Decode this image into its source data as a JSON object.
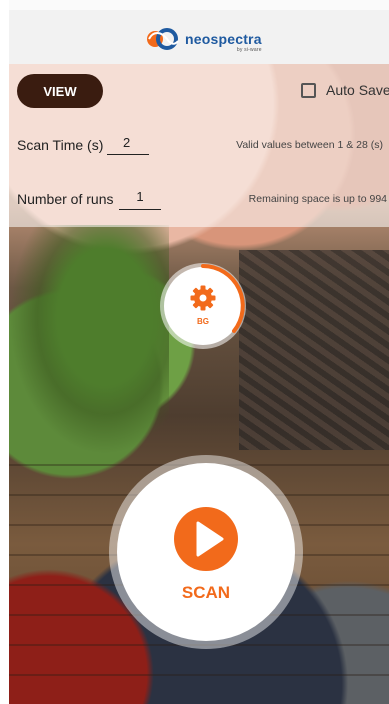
{
  "header": {
    "logo_text": "neospectra",
    "logo_subtext": "by si-ware"
  },
  "toolbar": {
    "view_label": "VIEW",
    "auto_save_label": "Auto Save",
    "auto_save_checked": false
  },
  "settings": {
    "scan_time_label": "Scan Time (s)",
    "scan_time_value": "2",
    "scan_time_hint": "Valid values between 1 & 28 (s)",
    "runs_label": "Number of runs",
    "runs_value": "1",
    "runs_hint": "Remaining space is up to 994"
  },
  "actions": {
    "background_label": "BG",
    "scan_label": "SCAN"
  },
  "colors": {
    "accent": "#f26a1b",
    "view_button": "#3a1c10",
    "brand_blue": "#1f5aa0"
  },
  "icons": {
    "background": "gear-icon",
    "scan": "play-icon"
  }
}
